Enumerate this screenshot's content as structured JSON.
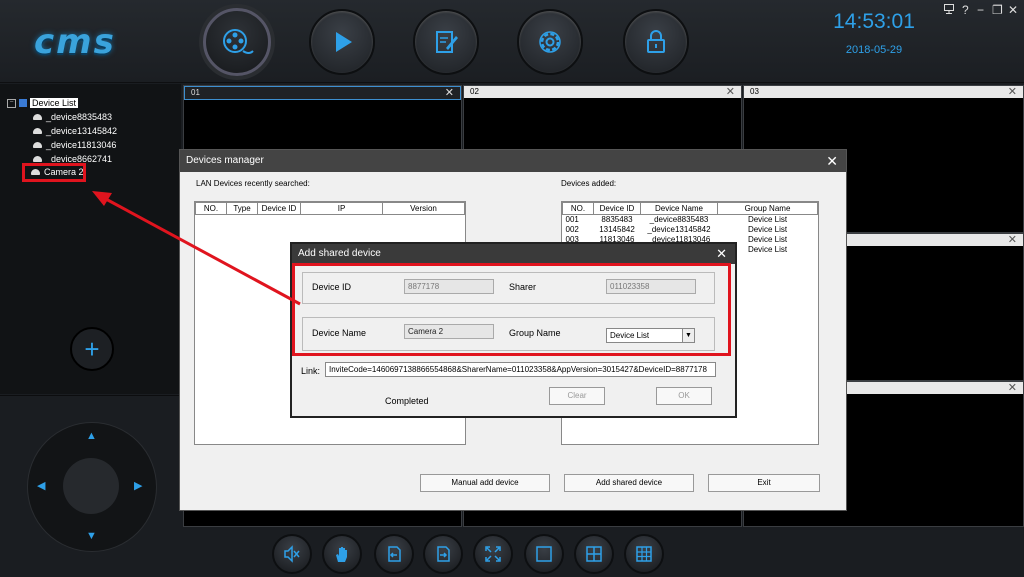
{
  "header": {
    "logo": "cms",
    "time": "14:53:01",
    "date": "2018-05-29",
    "window_controls": [
      "?",
      "−",
      "❐",
      "✕"
    ]
  },
  "nav": [
    {
      "name": "video-reel-icon"
    },
    {
      "name": "play-icon"
    },
    {
      "name": "edit-icon"
    },
    {
      "name": "gear-icon"
    },
    {
      "name": "lock-icon"
    }
  ],
  "tree": {
    "root": "Device List",
    "devices": [
      "_device8835483",
      "_device13145842",
      "_device11813046",
      "_device8662741",
      "Camera 2"
    ]
  },
  "video_cells": [
    "01",
    "02",
    "03"
  ],
  "devices_manager": {
    "title": "Devices manager",
    "lan_label": "LAN Devices recently searched:",
    "lan_headers": [
      "NO.",
      "Type",
      "Device ID",
      "IP",
      "Version"
    ],
    "added_label": "Devices added:",
    "added_headers": [
      "NO.",
      "Device ID",
      "Device Name",
      "Group Name"
    ],
    "added_rows": [
      [
        "001",
        "8835483",
        "_device8835483",
        "Device List"
      ],
      [
        "002",
        "13145842",
        "_device13145842",
        "Device List"
      ],
      [
        "003",
        "11813046",
        "_device11813046",
        "Device List"
      ],
      [
        "004",
        "",
        "",
        "Device List"
      ]
    ],
    "manual_add": "Manual add device",
    "add_shared": "Add shared device",
    "exit": "Exit"
  },
  "add_shared": {
    "title": "Add shared device",
    "device_id_label": "Device ID",
    "device_id": "8877178",
    "sharer_label": "Sharer",
    "sharer": "011023358",
    "device_name_label": "Device Name",
    "device_name": "Camera 2",
    "group_name_label": "Group Name",
    "group_name": "Device List",
    "link_label": "Link:",
    "link": "InviteCode=1460697138866554868&SharerName=011023358&AppVersion=3015427&DeviceID=8877178",
    "status": "Completed",
    "clear": "Clear",
    "ok": "OK"
  }
}
